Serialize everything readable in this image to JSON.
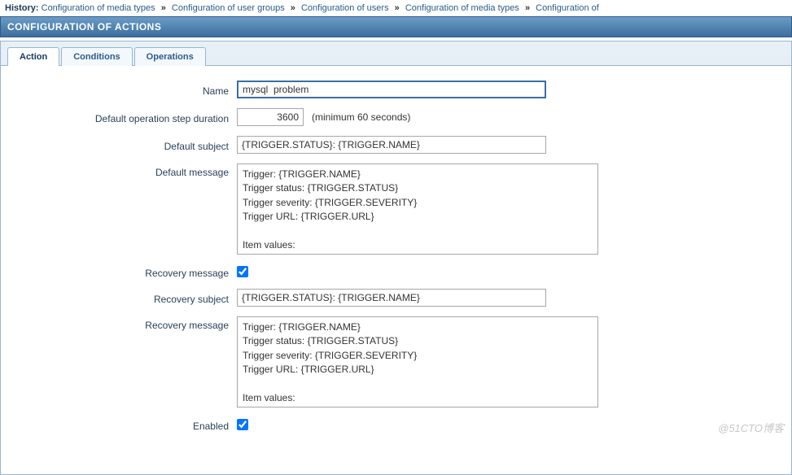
{
  "history": {
    "label": "History:",
    "items": [
      "Configuration of media types",
      "Configuration of user groups",
      "Configuration of users",
      "Configuration of media types",
      "Configuration of"
    ],
    "sep": "»"
  },
  "pageheader": {
    "title": "CONFIGURATION OF ACTIONS"
  },
  "tabs": {
    "action": "Action",
    "conditions": "Conditions",
    "operations": "Operations"
  },
  "form": {
    "name_label": "Name",
    "name_value": "mysql  problem",
    "duration_label": "Default operation step duration",
    "duration_value": "3600",
    "duration_hint": "(minimum 60 seconds)",
    "default_subject_label": "Default subject",
    "default_subject_value": "{TRIGGER.STATUS}: {TRIGGER.NAME}",
    "default_message_label": "Default message",
    "default_message_value": "Trigger: {TRIGGER.NAME}\nTrigger status: {TRIGGER.STATUS}\nTrigger severity: {TRIGGER.SEVERITY}\nTrigger URL: {TRIGGER.URL}\n\nItem values:\n",
    "recovery_checkbox_label": "Recovery message",
    "recovery_checked": true,
    "recovery_subject_label": "Recovery subject",
    "recovery_subject_value": "{TRIGGER.STATUS}: {TRIGGER.NAME}",
    "recovery_message_label": "Recovery message",
    "recovery_message_value": "Trigger: {TRIGGER.NAME}\nTrigger status: {TRIGGER.STATUS}\nTrigger severity: {TRIGGER.SEVERITY}\nTrigger URL: {TRIGGER.URL}\n\nItem values:\n",
    "enabled_label": "Enabled",
    "enabled_checked": true
  },
  "watermark": "@51CTO博客"
}
